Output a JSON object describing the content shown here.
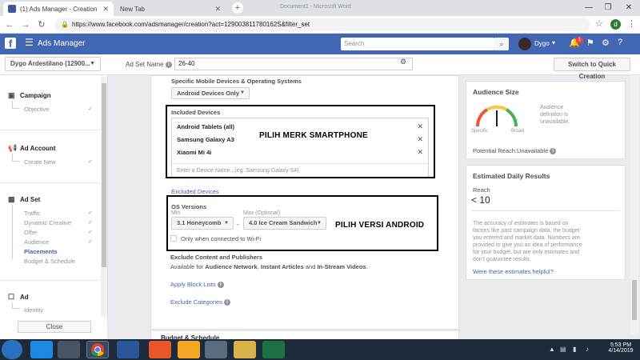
{
  "browser": {
    "tabs": [
      {
        "title": "(1) Ads Manager - Creation",
        "active": true
      },
      {
        "title": "New Tab",
        "active": false
      }
    ],
    "window_title": "Document1 - Microsoft Word",
    "url": "https://www.facebook.com/adsmanager/creation?act=129003811780162S&filter_set",
    "profile_initial": "d"
  },
  "fb_header": {
    "title": "Ads Manager",
    "search_placeholder": "Search",
    "user_name": "Dygo",
    "notification_count": "1"
  },
  "subheader": {
    "account": "Dygo Ardestilano (12900...",
    "adset_label": "Ad Set Name",
    "adset_value": "26-40",
    "quick_button": "Switch to Quick Creation"
  },
  "sidebar": {
    "campaign": {
      "label": "Campaign",
      "subs": [
        "Objective"
      ]
    },
    "ad_account": {
      "label": "Ad Account",
      "subs": [
        "Create New"
      ]
    },
    "ad_set": {
      "label": "Ad Set",
      "subs": [
        "Traffic",
        "Dynamic Creative",
        "Offer",
        "Audience",
        "Placements",
        "Budget & Schedule"
      ],
      "selected": "Placements"
    },
    "ad": {
      "label": "Ad",
      "subs": [
        "Identity"
      ]
    },
    "close": "Close"
  },
  "main": {
    "specific_label": "Specific Mobile Devices & Operating Systems",
    "device_type": "Android Devices Only",
    "included_label": "Included Devices",
    "devices": [
      "Android Tablets (all)",
      "Samsung Galaxy A3",
      "Xiaomi Mi 4i"
    ],
    "device_input_placeholder": "Enter a Device Name...(eg. Samsung Galaxy S4)",
    "excluded_label": "Excluded Devices",
    "os_label": "OS Versions",
    "min_label": "Min",
    "max_label": "Max (Optional)",
    "os_min": "3.1 Honeycomb",
    "os_max": "4.0 Ice Cream Sandwich",
    "dash": "-",
    "wifi_label": "Only when connected to Wi-Fi",
    "exclude_content_label": "Exclude Content and Publishers",
    "available_prefix": "Available for",
    "available_network": "Audience Network",
    "available_sep": ",",
    "available_instant": "Instant Articles",
    "available_and": "and",
    "available_stream": "In-Stream Videos",
    "apply_block": "Apply Block Lists",
    "exclude_categories": "Exclude Categories",
    "budget_heading": "Budget & Schedule"
  },
  "annotations": {
    "brand": "PILIH MERK SMARTPHONE",
    "os": "PILIH VERSI ANDROID"
  },
  "audience_card": {
    "title": "Audience Size",
    "note": [
      "Audience",
      "definition is",
      "unavailable."
    ],
    "specific": "Specific",
    "broad": "Broad",
    "reach_label": "Potential Reach:",
    "reach_value": "Unavailable"
  },
  "daily_card": {
    "title": "Estimated Daily Results",
    "reach_label": "Reach",
    "reach_value": "< 10",
    "desc": [
      "The accuracy of estimates is based on",
      "factors like past campaign data, the budget",
      "you entered and market data. Numbers are",
      "provided to give you an idea of performance",
      "for your budget, but are only estimates and",
      "don't guarantee results."
    ],
    "helpful": "Were these estimates helpful?"
  },
  "taskbar": {
    "time": "5:53 PM",
    "date": "4/14/2019"
  },
  "colors": {
    "fb_blue": "#4267b2",
    "link_blue": "#4267b2",
    "gauge_red": "#e9573f",
    "gauge_yellow": "#f7c744",
    "gauge_green": "#4caf50"
  }
}
